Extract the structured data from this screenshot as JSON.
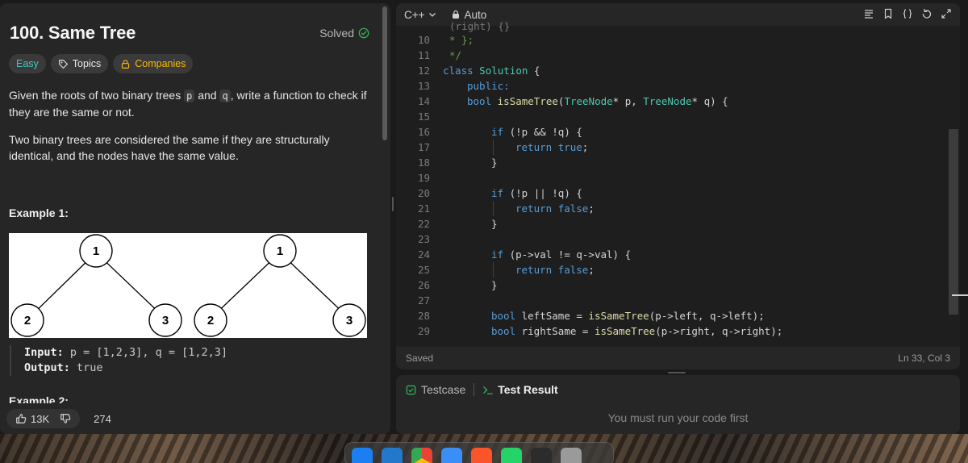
{
  "problem": {
    "title": "100. Same Tree",
    "status": "Solved",
    "tags": [
      "Easy",
      "Topics",
      "Companies"
    ],
    "description_1_pre": "Given the roots of two binary trees ",
    "description_1_p": "p",
    "description_1_mid": " and ",
    "description_1_q": "q",
    "description_1_post": ", write a function to check if they are the same or not.",
    "description_2": "Two binary trees are considered the same if they are structurally identical, and the nodes have the same value.",
    "example1_title": "Example 1:",
    "example1_input_label": "Input:",
    "example1_input": " p = [1,2,3], q = [1,2,3]",
    "example1_output_label": "Output:",
    "example1_output": " true",
    "example2_title": "Example 2:",
    "tree_nodes": [
      "1",
      "2",
      "3",
      "2",
      "1",
      "3"
    ]
  },
  "footer": {
    "likes": "13K",
    "comments": "274"
  },
  "editor": {
    "language": "C++",
    "mode": "Auto",
    "status_left": "Saved",
    "status_right": "Ln 33, Col 3",
    "partial_top_line": "(right) {}",
    "lines": [
      {
        "num": "10",
        "text": "* };"
      },
      {
        "num": "11",
        "text": "*/"
      },
      {
        "num": "12",
        "text": "class Solution {"
      },
      {
        "num": "13",
        "text": "public:"
      },
      {
        "num": "14",
        "text": "bool isSameTree(TreeNode* p, TreeNode* q) {"
      },
      {
        "num": "15",
        "text": ""
      },
      {
        "num": "16",
        "text": "if (!p && !q) {"
      },
      {
        "num": "17",
        "text": "return true;"
      },
      {
        "num": "18",
        "text": "}"
      },
      {
        "num": "19",
        "text": ""
      },
      {
        "num": "20",
        "text": "if (!p || !q) {"
      },
      {
        "num": "21",
        "text": "return false;"
      },
      {
        "num": "22",
        "text": "}"
      },
      {
        "num": "23",
        "text": ""
      },
      {
        "num": "24",
        "text": "if (p->val != q->val) {"
      },
      {
        "num": "25",
        "text": "return false;"
      },
      {
        "num": "26",
        "text": "}"
      },
      {
        "num": "27",
        "text": ""
      },
      {
        "num": "28",
        "text": "bool leftSame = isSameTree(p->left, q->left);"
      },
      {
        "num": "29",
        "text": "bool rightSame = isSameTree(p->right, q->right);"
      }
    ]
  },
  "result": {
    "tab_testcase": "Testcase",
    "tab_result": "Test Result",
    "message": "You must run your code first"
  },
  "colors": {
    "easy": "#46c6c2",
    "companies": "#ffb800",
    "solved_check": "#2cbb5d",
    "star": "#ffc01e"
  }
}
